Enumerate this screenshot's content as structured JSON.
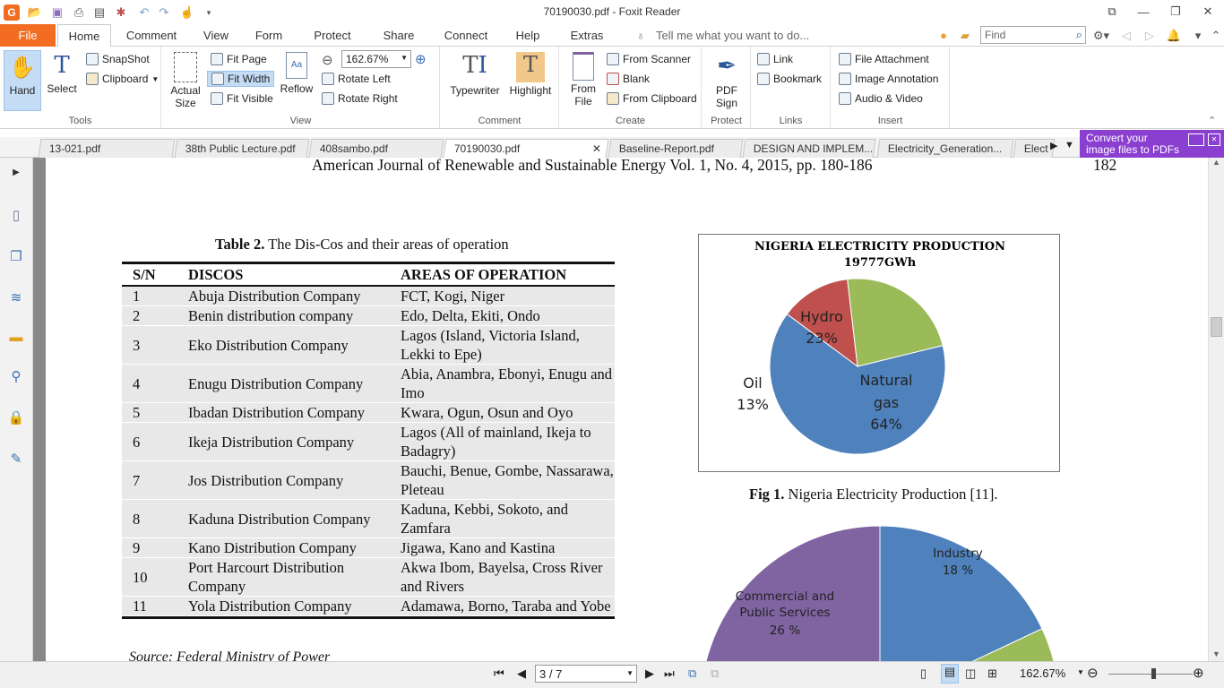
{
  "window": {
    "title": "70190030.pdf - Foxit Reader",
    "find_placeholder": "Find"
  },
  "menu": {
    "file": "File",
    "items": [
      "Home",
      "Comment",
      "View",
      "Form",
      "Protect",
      "Share",
      "Connect",
      "Help",
      "Extras"
    ],
    "tell_me": "Tell me what you want to do..."
  },
  "ribbon": {
    "tools": {
      "label": "Tools",
      "hand": "Hand",
      "select": "Select",
      "snapshot": "SnapShot",
      "clipboard": "Clipboard"
    },
    "view": {
      "label": "View",
      "actual_size_1": "Actual",
      "actual_size_2": "Size",
      "fit_page": "Fit Page",
      "fit_width": "Fit Width",
      "fit_visible": "Fit Visible",
      "reflow": "Reflow",
      "zoom": "162.67%",
      "rotate_left": "Rotate Left",
      "rotate_right": "Rotate Right"
    },
    "comment": {
      "label": "Comment",
      "typewriter": "Typewriter",
      "highlight": "Highlight"
    },
    "create": {
      "label": "Create",
      "from_file_1": "From",
      "from_file_2": "File",
      "from_scanner": "From Scanner",
      "blank": "Blank",
      "from_clipboard": "From Clipboard"
    },
    "protect": {
      "label": "Protect",
      "pdf_sign_1": "PDF",
      "pdf_sign_2": "Sign"
    },
    "links": {
      "label": "Links",
      "link": "Link",
      "bookmark": "Bookmark"
    },
    "insert": {
      "label": "Insert",
      "file_attachment": "File Attachment",
      "image_annotation": "Image Annotation",
      "audio_video": "Audio & Video"
    }
  },
  "doc_tabs": [
    "13-021.pdf",
    "38th Public Lecture.pdf",
    "408sambo.pdf",
    "70190030.pdf",
    "Baseline-Report.pdf",
    "DESIGN AND IMPLEM...",
    "Electricity_Generation...",
    "Elect"
  ],
  "promo": {
    "line1": "Convert your",
    "line2": "image files to PDFs"
  },
  "document": {
    "header": "American Journal of Renewable and Sustainable Energy Vol. 1, No. 4, 2015, pp. 180-186",
    "page_number": "182",
    "table_caption_bold": "Table 2.",
    "table_caption": " The Dis-Cos and their areas of operation",
    "table_headers": [
      "S/N",
      "DISCOS",
      "AREAS OF OPERATION"
    ],
    "table_rows": [
      [
        "1",
        "Abuja Distribution Company",
        "FCT, Kogi, Niger"
      ],
      [
        "2",
        "Benin distribution company",
        "Edo, Delta, Ekiti, Ondo"
      ],
      [
        "3",
        "Eko Distribution Company",
        "Lagos (Island, Victoria Island, Lekki to Epe)"
      ],
      [
        "4",
        "Enugu Distribution Company",
        "Abia, Anambra, Ebonyi, Enugu and Imo"
      ],
      [
        "5",
        "Ibadan Distribution Company",
        "Kwara, Ogun, Osun and Oyo"
      ],
      [
        "6",
        "Ikeja Distribution Company",
        "Lagos (All of mainland, Ikeja to Badagry)"
      ],
      [
        "7",
        "Jos Distribution Company",
        "Bauchi, Benue, Gombe, Nassarawa, Pleteau"
      ],
      [
        "8",
        "Kaduna Distribution Company",
        "Kaduna, Kebbi, Sokoto, and Zamfara"
      ],
      [
        "9",
        "Kano Distribution Company",
        "Jigawa, Kano and Kastina"
      ],
      [
        "10",
        "Port Harcourt Distribution Company",
        "Akwa Ibom, Bayelsa, Cross River and Rivers"
      ],
      [
        "11",
        "Yola Distribution Company",
        "Adamawa, Borno, Taraba and Yobe"
      ]
    ],
    "source": "Source: Federal Ministry of Power",
    "fig1_caption_bold": "Fig 1.",
    "fig1_caption": " Nigeria Electricity Production [11]."
  },
  "chart_data": [
    {
      "type": "pie",
      "title": "NIGERIA ELECTRICITY PRODUCTION",
      "subtitle": "19777GWh",
      "categories": [
        "Natural gas",
        "Oil",
        "Hydro"
      ],
      "values": [
        64,
        13,
        23
      ],
      "labels": [
        "Natural gas 64%",
        "Oil 13%",
        "Hydro 23%"
      ],
      "colors": [
        "#4f81bd",
        "#c0504d",
        "#9bbb59"
      ]
    },
    {
      "type": "pie",
      "partial": true,
      "categories": [
        "Industry",
        "Commercial and Public Services"
      ],
      "values": [
        18,
        26
      ],
      "labels": [
        "Industry 18 %",
        "Commercial and Public Services 26 %"
      ],
      "colors": [
        "#4f81bd",
        "#9bbb59",
        "#8064a2"
      ]
    }
  ],
  "status": {
    "page_indicator": "3 / 7",
    "zoom": "162.67%"
  }
}
